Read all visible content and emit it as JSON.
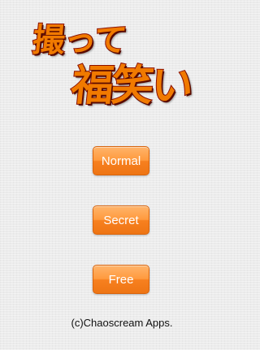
{
  "logo": {
    "line1": "撮って",
    "line2": "福笑い"
  },
  "menu": {
    "normal_label": "Normal",
    "secret_label": "Secret",
    "free_label": "Free"
  },
  "footer": {
    "copyright": "(c)Chaoscream Apps."
  },
  "colors": {
    "button_accent": "#f7801f",
    "logo_fill": "#f07a00",
    "logo_outline": "#8a0f00"
  }
}
